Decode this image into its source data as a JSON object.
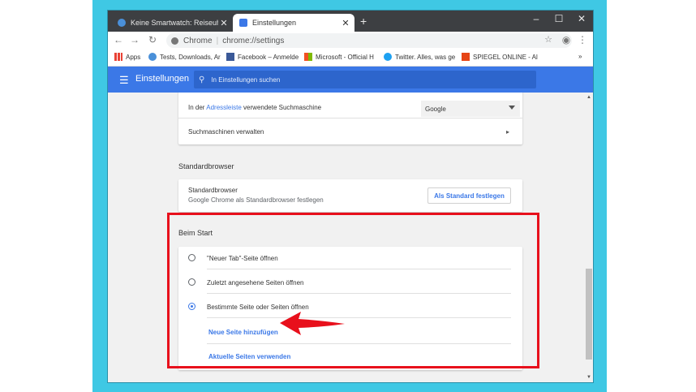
{
  "browser": {
    "tabs": [
      {
        "label": "Keine Smartwatch: Reiseuhr von"
      },
      {
        "label": "Einstellungen"
      }
    ],
    "new_tab": "+",
    "controls": {
      "minimize": "–",
      "maximize": "☐",
      "close": "✕"
    },
    "tab_close": "✕"
  },
  "omnibar": {
    "chrome_label": "Chrome",
    "separator": "|",
    "url": "chrome://settings"
  },
  "bookmarks": [
    {
      "label": "Apps"
    },
    {
      "label": "Tests, Downloads, Ar"
    },
    {
      "label": "Facebook – Anmelde"
    },
    {
      "label": "Microsoft - Official H"
    },
    {
      "label": "Twitter. Alles, was ge"
    },
    {
      "label": "SPIEGEL ONLINE - Al"
    }
  ],
  "bookmarks_more": "»",
  "settings_header": {
    "title": "Einstellungen",
    "search_placeholder": "In Einstellungen suchen"
  },
  "search_engine": {
    "label_prefix": "In der ",
    "label_link": "Adressleiste",
    "label_suffix": " verwendete Suchmaschine",
    "selected": "Google",
    "manage_label": "Suchmaschinen verwalten",
    "manage_chevron": "▸"
  },
  "default_browser": {
    "section_title": "Standardbrowser",
    "row_title": "Standardbrowser",
    "row_subtitle": "Google Chrome als Standardbrowser festlegen",
    "button": "Als Standard festlegen"
  },
  "on_startup": {
    "section_title": "Beim Start",
    "options": [
      {
        "label": "\"Neuer Tab\"-Seite öffnen",
        "selected": false
      },
      {
        "label": "Zuletzt angesehene Seiten öffnen",
        "selected": false
      },
      {
        "label": "Bestimmte Seite oder Seiten öffnen",
        "selected": true
      }
    ],
    "add_page": "Neue Seite hinzufügen",
    "use_current": "Aktuelle Seiten verwenden"
  },
  "scroll": {
    "up": "▲",
    "down": "▼"
  },
  "colors": {
    "accent": "#3b78e7",
    "highlight": "#e8101c",
    "background": "#3fc8e4"
  }
}
